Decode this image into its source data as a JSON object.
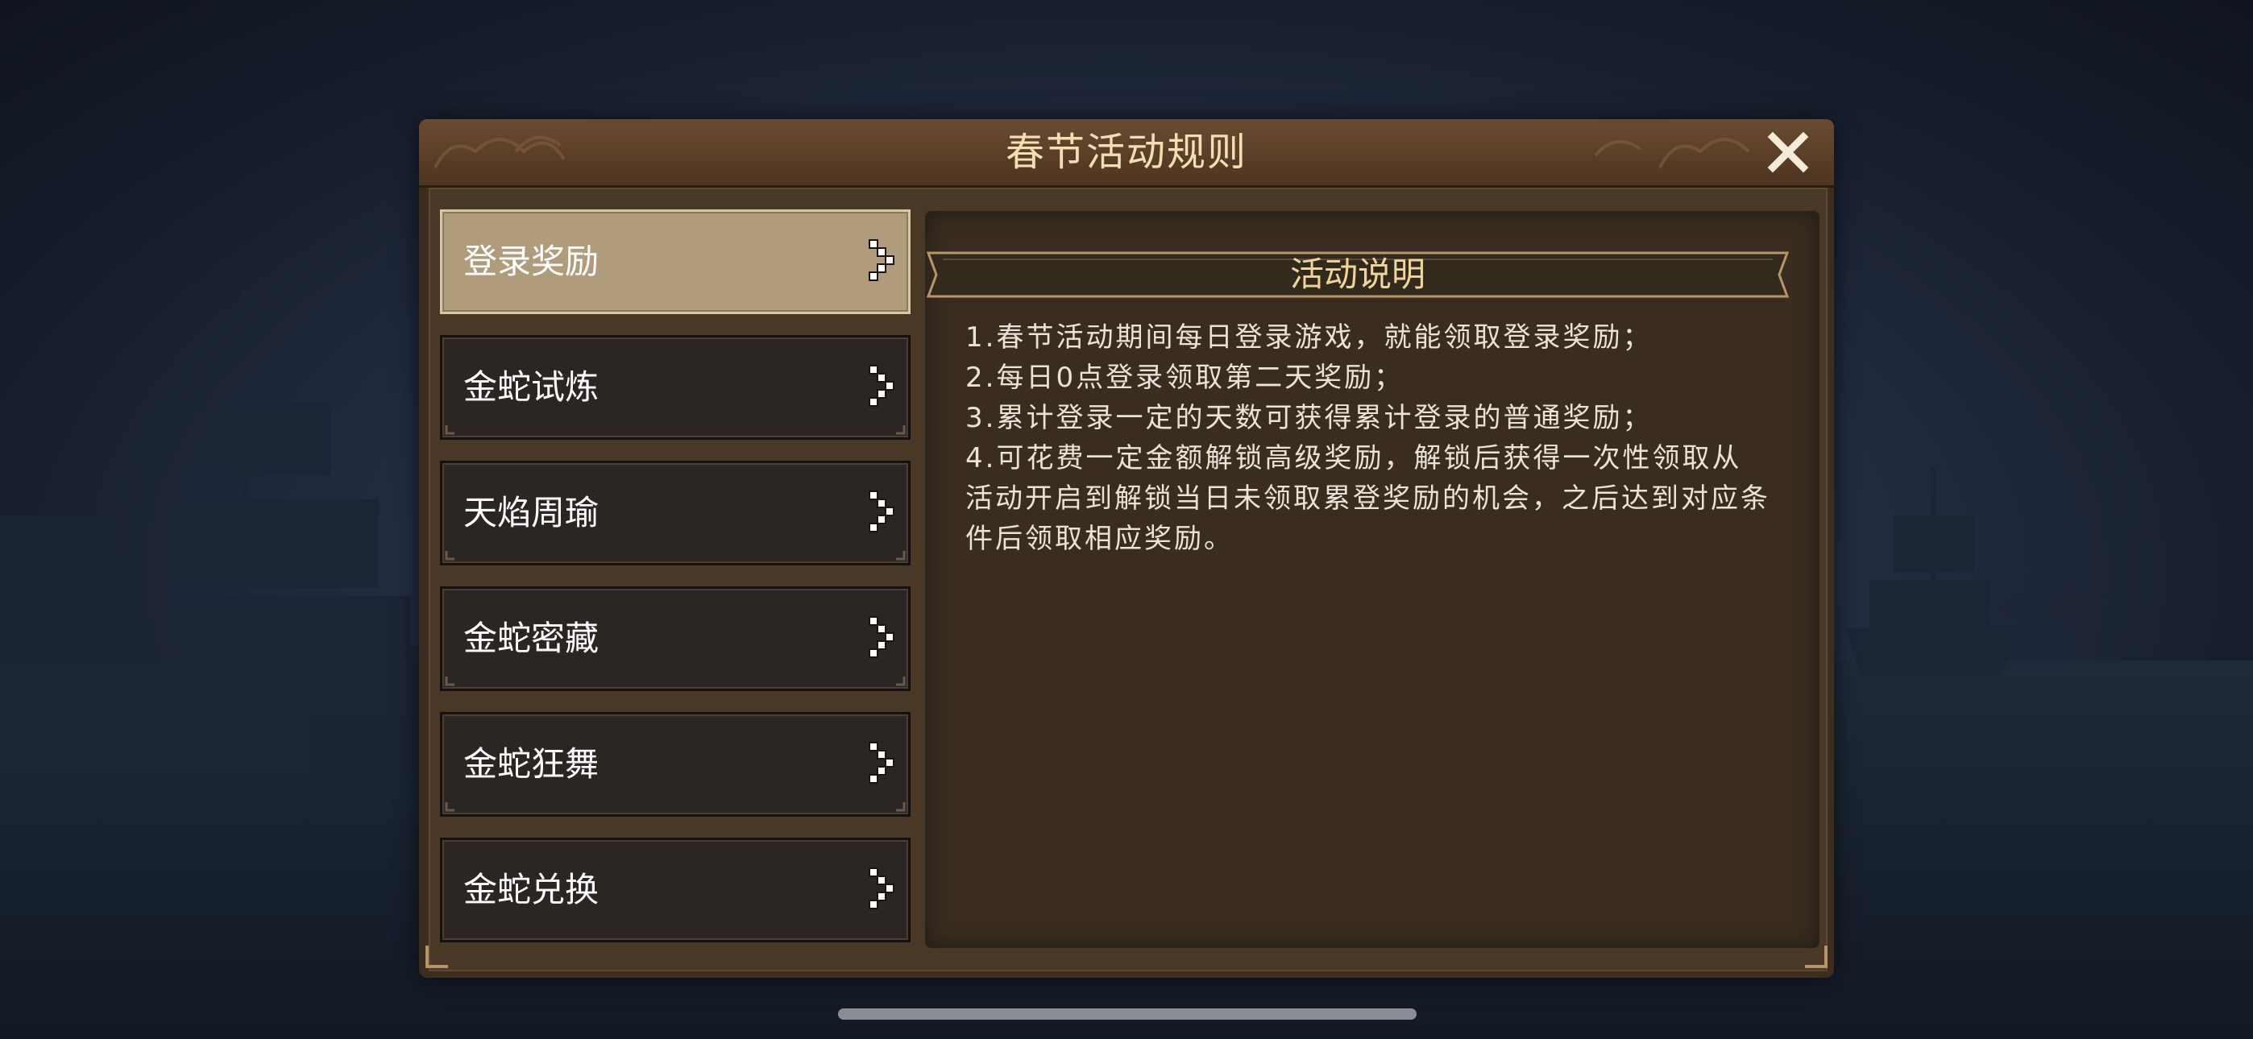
{
  "dialog": {
    "title": "春节活动规则",
    "close_label": "X"
  },
  "menu": {
    "items": [
      {
        "label": "登录奖励",
        "active": true
      },
      {
        "label": "金蛇试炼",
        "active": false
      },
      {
        "label": "天焰周瑜",
        "active": false
      },
      {
        "label": "金蛇密藏",
        "active": false
      },
      {
        "label": "金蛇狂舞",
        "active": false
      },
      {
        "label": "金蛇兑换",
        "active": false
      }
    ]
  },
  "content": {
    "section_title": "活动说明",
    "rules": [
      "1.春节活动期间每日登录游戏，就能领取登录奖励；",
      "2.每日0点登录领取第二天奖励；",
      "3.累计登录一定的天数可获得累计登录的普通奖励；",
      "4.可花费一定金额解锁高级奖励，解锁后获得一次性领取从活动开启到解锁当日未领取累登奖励的机会，之后达到对应条件后领取相应奖励。"
    ]
  },
  "colors": {
    "title_text": "#f2dfb4",
    "section_title_text": "#f0d49a",
    "active_tab": "#b09c7b",
    "inactive_tab": "#2b2624",
    "panel_bg": "#3a2d20"
  },
  "icons": {
    "close": "close-icon",
    "menu_arrow": "chevron-right-icon"
  }
}
